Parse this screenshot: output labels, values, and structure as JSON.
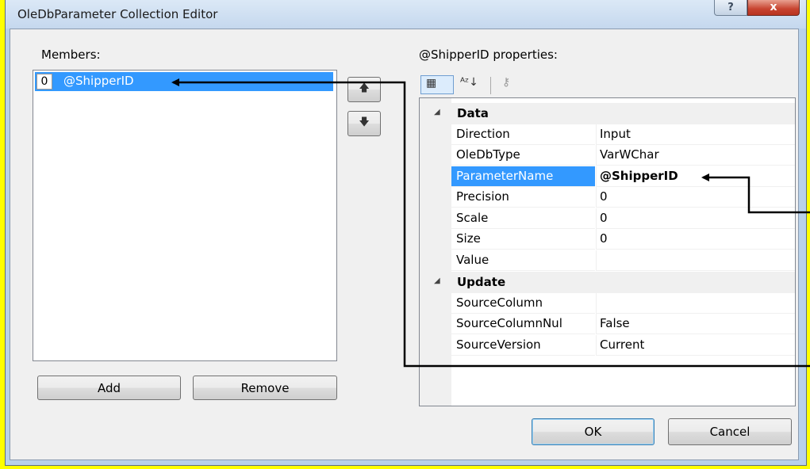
{
  "window": {
    "title": "OleDbParameter Collection Editor",
    "help_glyph": "?",
    "close_glyph": "x"
  },
  "members": {
    "label": "Members:",
    "items": [
      {
        "index": "0",
        "name": "@ShipperID"
      }
    ],
    "move_up_glyph": "🡅",
    "move_down_glyph": "🡇",
    "add_label": "Add",
    "remove_label": "Remove"
  },
  "properties": {
    "label": "@ShipperID properties:",
    "toolbar": {
      "categorized_icon": "▦",
      "alphabetical_icon": "ᴬᶻ↓",
      "property_pages_icon": "⚷"
    },
    "categories": [
      {
        "name": "Data",
        "rows": [
          {
            "name": "Direction",
            "value": "Input"
          },
          {
            "name": "OleDbType",
            "value": "VarWChar"
          },
          {
            "name": "ParameterName",
            "value": "@ShipperID"
          },
          {
            "name": "Precision",
            "value": "0"
          },
          {
            "name": "Scale",
            "value": "0"
          },
          {
            "name": "Size",
            "value": "0"
          },
          {
            "name": "Value",
            "value": ""
          }
        ]
      },
      {
        "name": "Update",
        "rows": [
          {
            "name": "SourceColumn",
            "value": ""
          },
          {
            "name": "SourceColumnNul",
            "value": "False"
          },
          {
            "name": "SourceVersion",
            "value": "Current"
          }
        ]
      }
    ],
    "collapse_glyph": "◢"
  },
  "dialog": {
    "ok_label": "OK",
    "cancel_label": "Cancel"
  },
  "colors": {
    "selection": "#3399ff",
    "highlight_border": "#ffff00",
    "annotation_arrow": "#000000"
  }
}
